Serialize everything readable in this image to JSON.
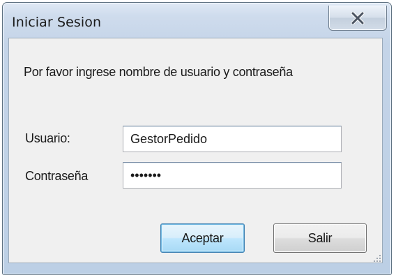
{
  "window": {
    "title": "Iniciar Sesion"
  },
  "titlebar": {
    "close_icon": "close-x-icon"
  },
  "dialog": {
    "prompt": "Por favor ingrese nombre de usuario y contraseña",
    "user_label": "Usuario:",
    "user_value": "GestorPedido",
    "password_label": "Contraseña",
    "password_mask": "•••••••",
    "accept_label": "Aceptar",
    "exit_label": "Salir"
  },
  "colors": {
    "frame": "#c4d4e8",
    "client": "#f0f0f0",
    "close_icon": "#4c5563",
    "default_button_border": "#3c7fb1"
  }
}
